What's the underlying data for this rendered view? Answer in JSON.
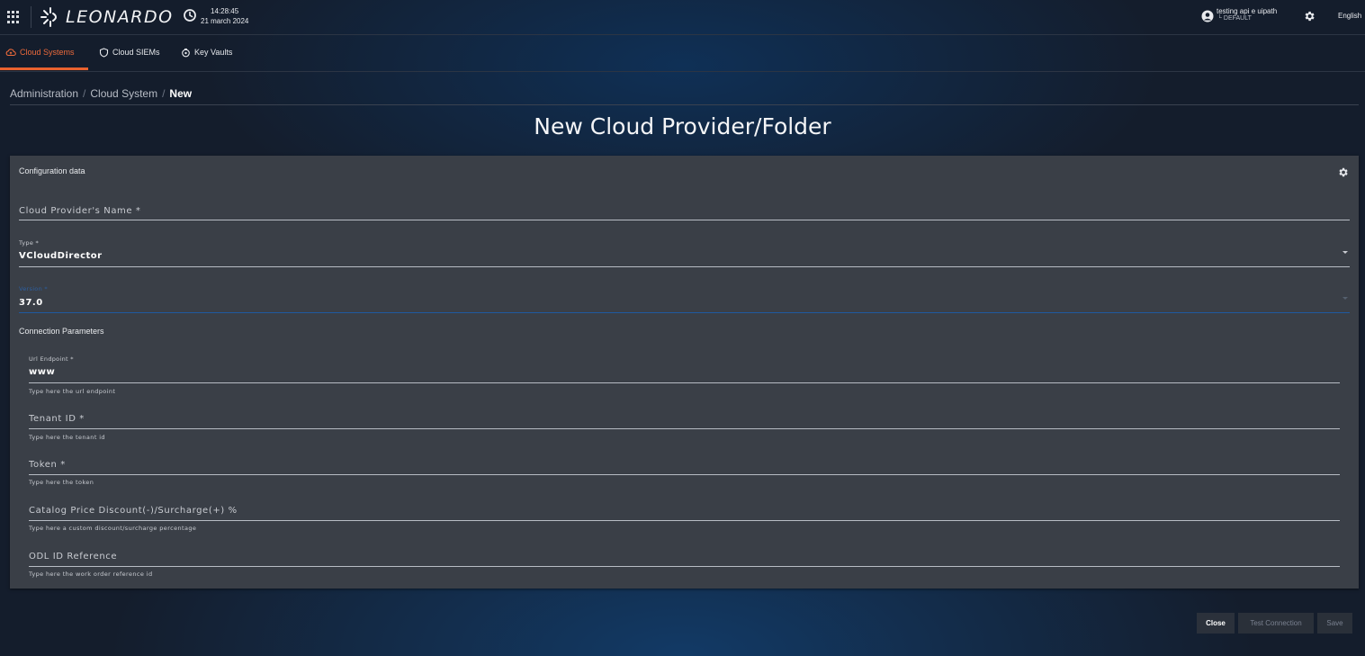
{
  "header": {
    "logo_text": "LEONARDO",
    "time": "14:28:45",
    "date": "21 march 2024",
    "user_name": "testing api e uipath",
    "user_tenant": "└ DEFAULT",
    "language": "English"
  },
  "tabs": [
    {
      "label": "Cloud Systems",
      "icon": "cloud-icon",
      "active": true
    },
    {
      "label": "Cloud SIEMs",
      "icon": "shield-icon",
      "active": false
    },
    {
      "label": "Key Vaults",
      "icon": "key-vault-icon",
      "active": false
    }
  ],
  "breadcrumb": {
    "items": [
      "Administration",
      "Cloud System"
    ],
    "current": "New",
    "separator": "/"
  },
  "page_title": "New Cloud Provider/Folder",
  "card": {
    "title": "Configuration data",
    "fields": {
      "name": {
        "placeholder": "Cloud Provider's Name *",
        "value": ""
      },
      "type": {
        "label": "Type *",
        "value": "VCloudDirector"
      },
      "version": {
        "label": "Version *",
        "value": "37.0"
      }
    },
    "connection_title": "Connection Parameters",
    "connection": {
      "url": {
        "label": "Url Endpoint *",
        "value": "www",
        "hint": "Type here the url endpoint"
      },
      "tenant": {
        "placeholder": "Tenant ID *",
        "hint": "Type here the tenant id"
      },
      "token": {
        "placeholder": "Token *",
        "hint": "Type here the token"
      },
      "discount": {
        "placeholder": "Catalog Price Discount(-)/Surcharge(+) %",
        "hint": "Type here a custom discount/surcharge percentage"
      },
      "odl": {
        "placeholder": "ODL ID Reference",
        "hint": "Type here the work order reference id"
      }
    }
  },
  "actions": {
    "close": "Close",
    "test_connection": "Test Connection",
    "save": "Save"
  },
  "colors": {
    "accent": "#e8622f",
    "background": "#141d2c",
    "card": "#3a3f47"
  }
}
